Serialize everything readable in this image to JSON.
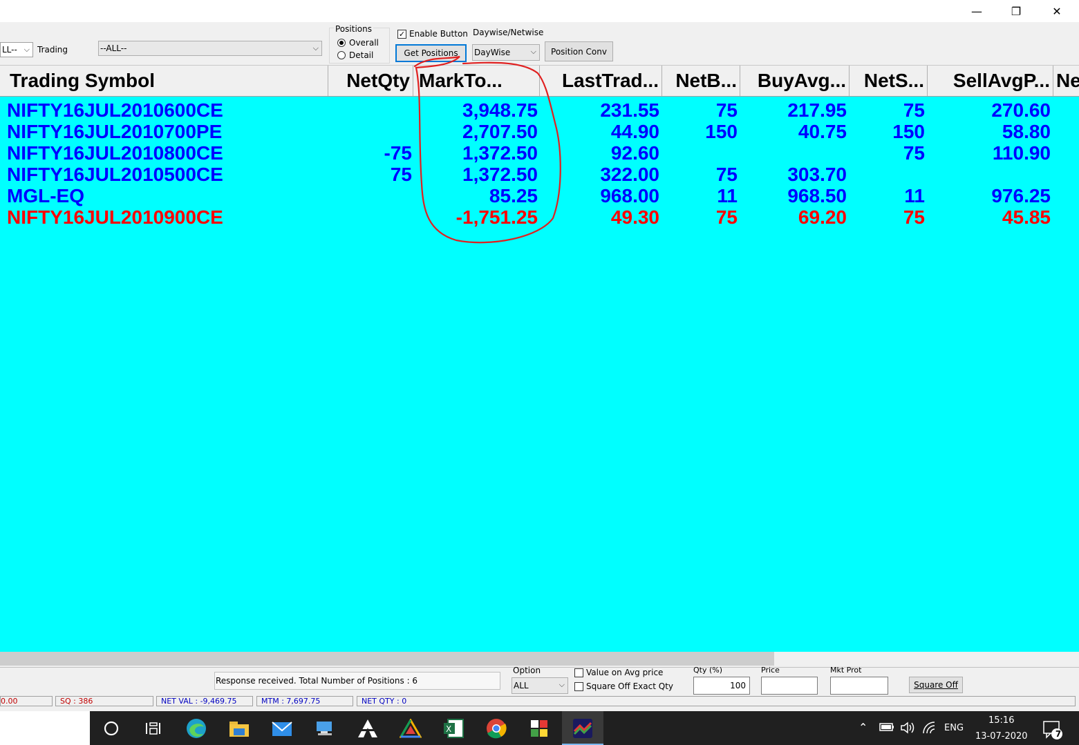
{
  "window": {
    "minimize": "—",
    "restore": "❐",
    "close": "✕"
  },
  "toolbar": {
    "first_combo": "LL--",
    "trading_label": "Trading",
    "trading_combo": "--ALL--",
    "positions_label": "Positions",
    "overall_label": "Overall",
    "detail_label": "Detail",
    "enable_button_label": "Enable Button",
    "daywise_netwise_label": "Daywise/Netwise",
    "get_positions": "Get Positions",
    "daywise_combo": "DayWise",
    "position_conv": "Position Conv"
  },
  "grid": {
    "headers": [
      "Trading Symbol",
      "NetQty",
      "MarkTo...",
      "LastTrad...",
      "NetB...",
      "BuyAvg...",
      "NetS...",
      "SellAvgP...",
      "Ne"
    ],
    "rows": [
      {
        "symbol": "NIFTY16JUL2010600CE",
        "netqty": "",
        "mtm": "3,948.75",
        "ltp": "231.55",
        "netb": "75",
        "buyavg": "217.95",
        "nets": "75",
        "sellavg": "270.60",
        "color": "#0000ff"
      },
      {
        "symbol": "NIFTY16JUL2010700PE",
        "netqty": "",
        "mtm": "2,707.50",
        "ltp": "44.90",
        "netb": "150",
        "buyavg": "40.75",
        "nets": "150",
        "sellavg": "58.80",
        "color": "#0000ff"
      },
      {
        "symbol": "NIFTY16JUL2010800CE",
        "netqty": "-75",
        "mtm": "1,372.50",
        "ltp": "92.60",
        "netb": "",
        "buyavg": "",
        "nets": "75",
        "sellavg": "110.90",
        "color": "#0000ff"
      },
      {
        "symbol": "NIFTY16JUL2010500CE",
        "netqty": "75",
        "mtm": "1,372.50",
        "ltp": "322.00",
        "netb": "75",
        "buyavg": "303.70",
        "nets": "",
        "sellavg": "",
        "color": "#0000ff"
      },
      {
        "symbol": "MGL-EQ",
        "netqty": "",
        "mtm": "85.25",
        "ltp": "968.00",
        "netb": "11",
        "buyavg": "968.50",
        "nets": "11",
        "sellavg": "976.25",
        "color": "#0000ff"
      },
      {
        "symbol": "NIFTY16JUL2010900CE",
        "netqty": "",
        "mtm": "-1,751.25",
        "ltp": "49.30",
        "netb": "75",
        "buyavg": "69.20",
        "nets": "75",
        "sellavg": "45.85",
        "color": "#ff0000"
      }
    ]
  },
  "bottom": {
    "response": "Response received.  Total Number of Positions : 6",
    "option_label": "Option",
    "option_combo": "ALL",
    "value_on_avg": "Value on Avg  price",
    "square_off_exact": "Square Off Exact Qty",
    "qty_label": "Qty (%)",
    "qty_value": "100",
    "price_label": "Price",
    "mkt_prot_label": "Mkt Prot",
    "square_off": "Square Off"
  },
  "status": {
    "first": "0.00",
    "sq": "SQ : 386",
    "net_val": "NET VAL : -9,469.75",
    "mtm": "MTM : 7,697.75",
    "net_qty": "NET QTY : 0"
  },
  "taskbar": {
    "lang": "ENG",
    "time": "15:16",
    "date": "13-07-2020",
    "notifications": "7"
  },
  "colors": {
    "grid_bg": "#00ffff",
    "positive": "#0000ff",
    "negative": "#ff0000",
    "annotation": "#e02020"
  }
}
